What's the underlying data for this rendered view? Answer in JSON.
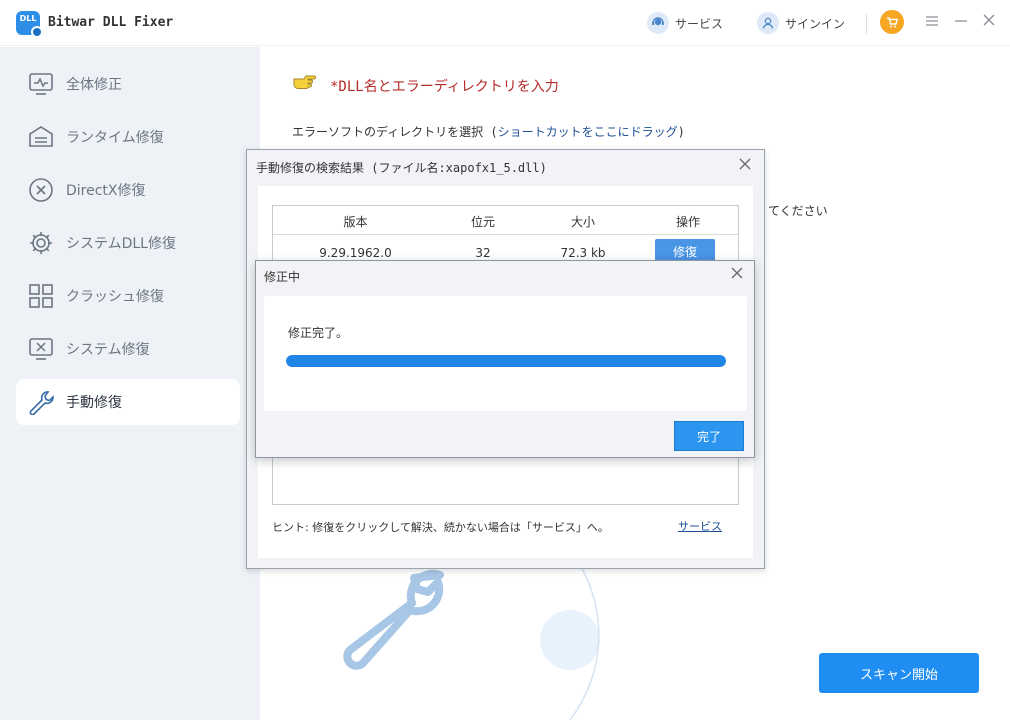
{
  "app": {
    "title": "Bitwar DLL Fixer",
    "logo_text": "DLL"
  },
  "header": {
    "service_label": "サービス",
    "signin_label": "サインイン"
  },
  "sidebar": {
    "items": [
      {
        "label": "全体修正",
        "icon": "monitor-pulse-icon",
        "active": false
      },
      {
        "label": "ランタイム修復",
        "icon": "runtime-layers-icon",
        "active": false
      },
      {
        "label": "DirectX修復",
        "icon": "directx-x-icon",
        "active": false
      },
      {
        "label": "システムDLL修復",
        "icon": "gear-icon",
        "active": false
      },
      {
        "label": "クラッシュ修復",
        "icon": "grid-icon",
        "active": false
      },
      {
        "label": "システム修復",
        "icon": "monitor-x-icon",
        "active": false
      },
      {
        "label": "手動修復",
        "icon": "wrench-icon",
        "active": true
      }
    ]
  },
  "main": {
    "heading": "*DLL名とエラーディレクトリを入力",
    "instruction_prefix": "エラーソフトのディレクトリを選択 (",
    "instruction_highlight": "ショートカットをここにドラッグ",
    "instruction_suffix": ")",
    "instruction_partial": "てください",
    "scan_button": "スキャン開始"
  },
  "search_dialog": {
    "title": "手動修復の検索結果 (ファイル名:xapofx1_5.dll)",
    "columns": [
      "版本",
      "位元",
      "大小",
      "操作"
    ],
    "rows": [
      {
        "version": "9.29.1962.0",
        "bits": "32",
        "size": "72.3 kb",
        "action": "修復"
      }
    ],
    "hint": "ヒント: 修復をクリックして解決、続かない場合は「サービス」へ。",
    "hint_link": "サービス"
  },
  "progress_dialog": {
    "title": "修正中",
    "message": "修正完了。",
    "progress": 1.0,
    "done_button": "完了"
  },
  "colors": {
    "accent": "#1f8df1",
    "heading_red": "#b72a2a",
    "sidebar_bg": "#eef2f7"
  }
}
